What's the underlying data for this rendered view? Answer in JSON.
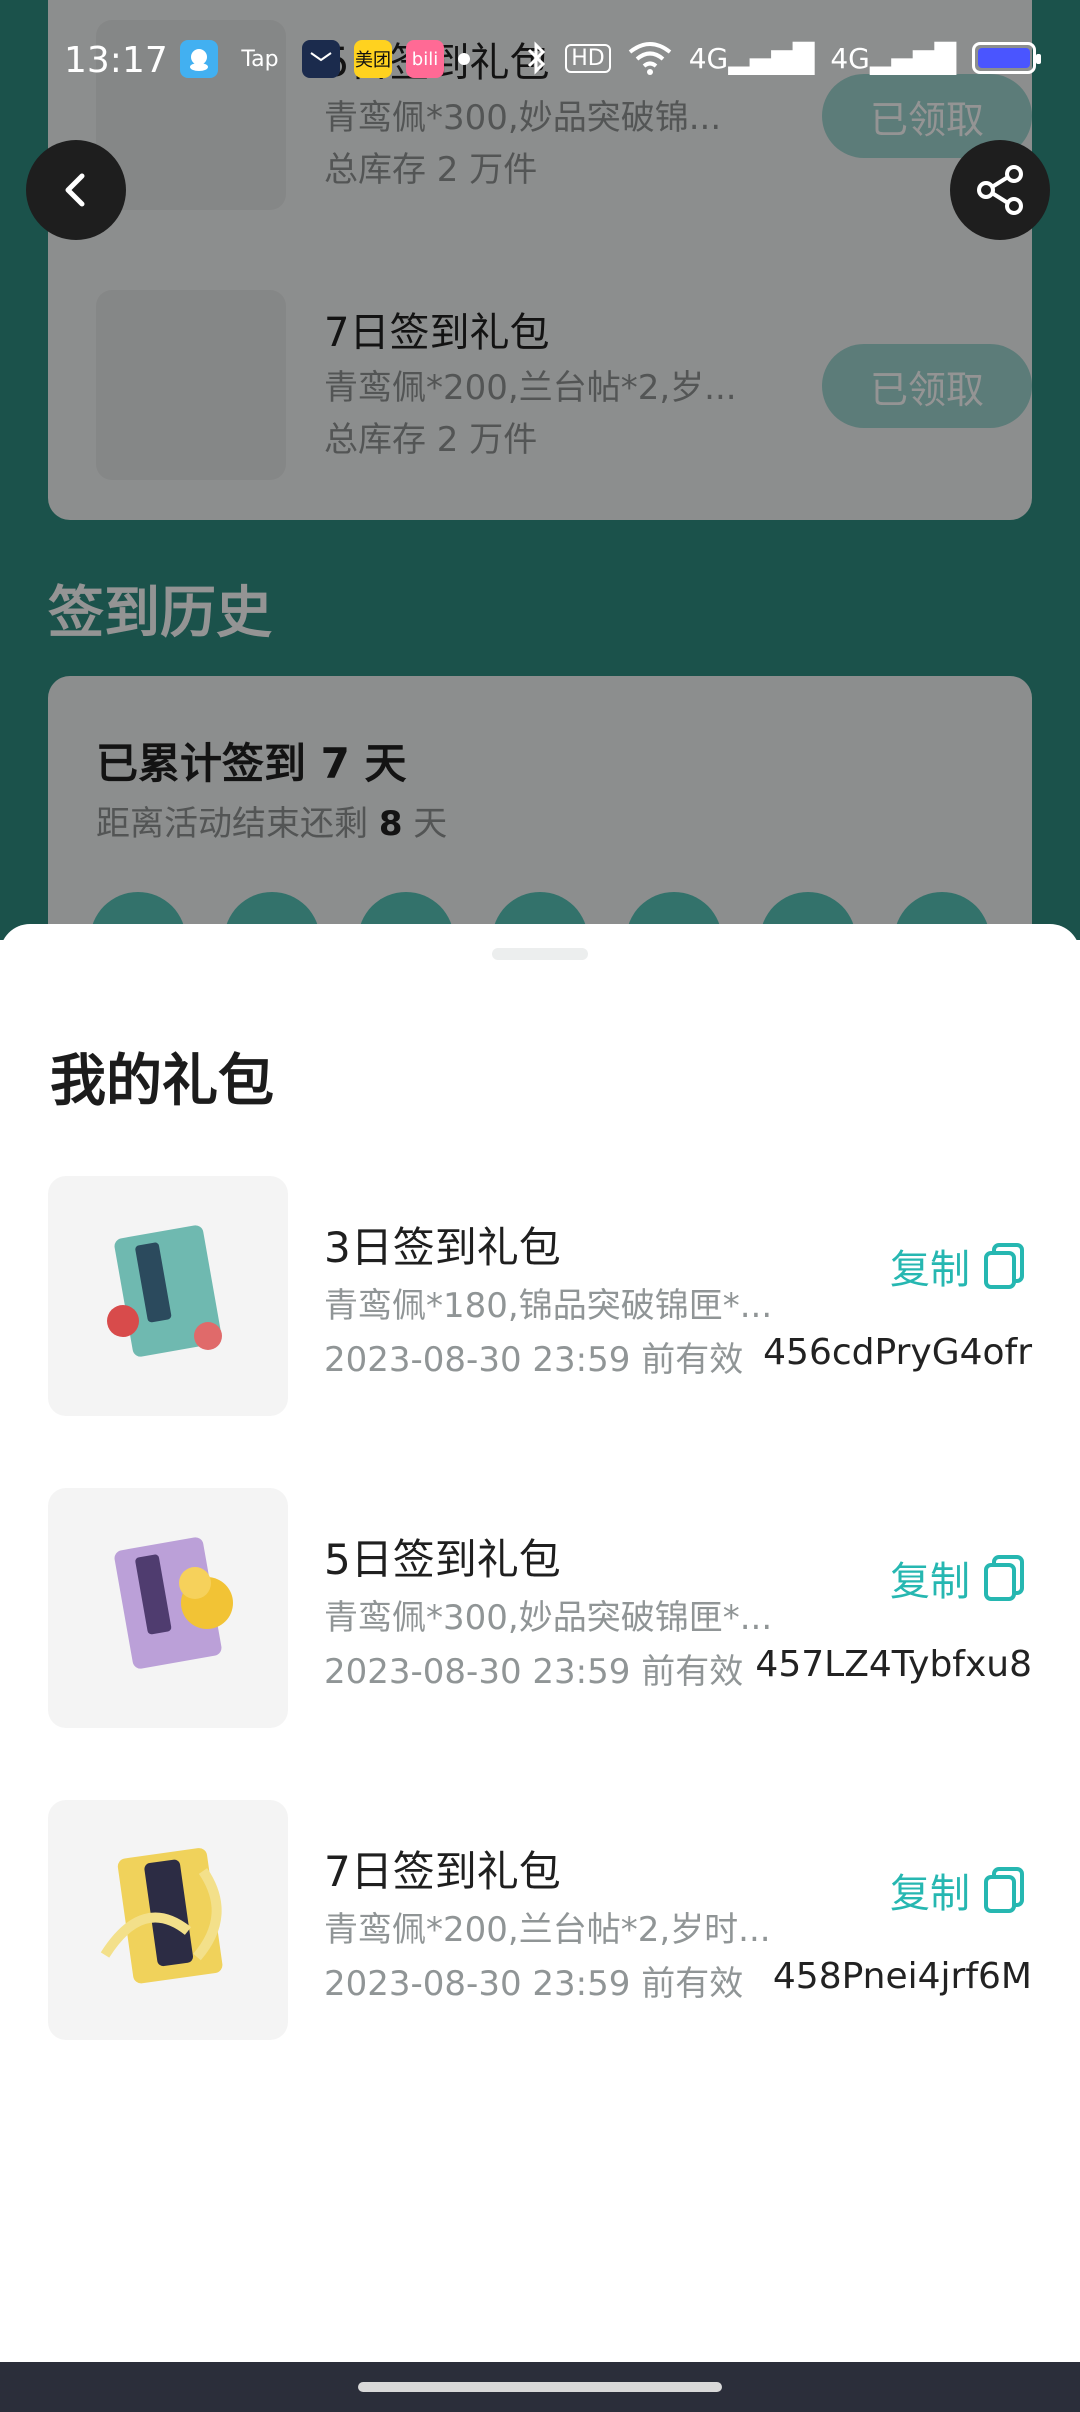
{
  "status_bar": {
    "time": "13:17",
    "icons_left": [
      "qq-icon",
      "tap-icon",
      "mail-icon",
      "meituan-icon",
      "bilibili-icon",
      "notification-dot"
    ],
    "left_labels": {
      "tap": "Tap",
      "meituan": "美团",
      "bili": "bili"
    },
    "right": {
      "hd": "HD",
      "net1": "4G",
      "net2": "4G"
    }
  },
  "background_page": {
    "rewards": [
      {
        "title": "5日签到礼包",
        "desc": "青鸾佩*300,妙品突破锦...",
        "stock": "总库存 2 万件",
        "button": "已领取"
      },
      {
        "title": "7日签到礼包",
        "desc": "青鸾佩*200,兰台帖*2,岁...",
        "stock": "总库存 2 万件",
        "button": "已领取"
      }
    ],
    "history_title": "签到历史",
    "summary_prefix": "已累计签到 ",
    "summary_days": "7",
    "summary_suffix": " 天",
    "remaining_prefix": "距离活动结束还剩 ",
    "remaining_days": "8",
    "remaining_suffix": " 天"
  },
  "sheet": {
    "title": "我的礼包",
    "items": [
      {
        "title": "3日签到礼包",
        "desc": "青鸾佩*180,锦品突破锦匣*...",
        "expiry": "2023-08-30 23:59 前有效",
        "copy_label": "复制",
        "code": "456cdPryG4ofr",
        "accent": "#d84b4b"
      },
      {
        "title": "5日签到礼包",
        "desc": "青鸾佩*300,妙品突破锦匣*...",
        "expiry": "2023-08-30 23:59 前有效",
        "copy_label": "复制",
        "code": "457LZ4Tybfxu8",
        "accent": "#f2c335"
      },
      {
        "title": "7日签到礼包",
        "desc": "青鸾佩*200,兰台帖*2,岁时...",
        "expiry": "2023-08-30 23:59 前有效",
        "copy_label": "复制",
        "code": "458Pnei4jrf6M",
        "accent": "#f0d25b"
      }
    ]
  },
  "colors": {
    "accent": "#26b7b1",
    "bg_green": "#2f8e82"
  }
}
